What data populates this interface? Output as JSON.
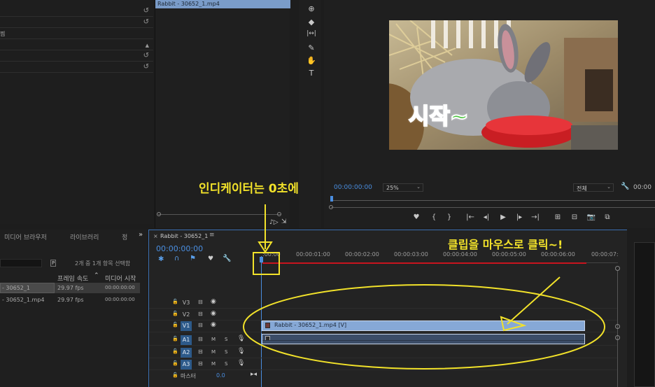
{
  "source_monitor": {
    "clip_label": "Rabbit - 30652_1.mp4",
    "left_label": "찜"
  },
  "tools": [
    {
      "name": "ripple-edit-icon",
      "glyph": "⊕"
    },
    {
      "name": "razor-icon",
      "glyph": "◆"
    },
    {
      "name": "slip-icon",
      "glyph": "|↔|"
    },
    {
      "name": "pen-icon",
      "glyph": "✎"
    },
    {
      "name": "hand-icon",
      "glyph": "✋"
    },
    {
      "name": "type-icon",
      "glyph": "T"
    }
  ],
  "program_monitor": {
    "overlay_text": "시작~",
    "timecode": "00:00:00:00",
    "zoom": "25%",
    "quality": "전체",
    "end_timecode": "00:00"
  },
  "project_panel": {
    "tabs": [
      "미디어 브라우저",
      "라이브러리",
      "정"
    ],
    "selection_info": "2개 중 1개 항목 선택함",
    "columns": [
      "프레임 속도",
      "미디어 시작"
    ],
    "items": [
      {
        "name": "- 30652_1",
        "fps": "29.97 fps",
        "start": "00:00:00:00"
      },
      {
        "name": "- 30652_1.mp4",
        "fps": "29.97 fps",
        "start": "00:00:00:00"
      }
    ]
  },
  "timeline": {
    "sequence_name": "Rabbit - 30652_1",
    "timecode": "00:00:00:00",
    "ruler": [
      ":00:00",
      "00:00:01:00",
      "00:00:02:00",
      "00:00:03:00",
      "00:00:04:00",
      "00:00:05:00",
      "00:00:06:00",
      "00:00:07:"
    ],
    "video_tracks": [
      "V3",
      "V2",
      "V1"
    ],
    "audio_tracks": [
      "A1",
      "A2",
      "A3"
    ],
    "track_m": "M",
    "track_s": "S",
    "master_label": "마스터",
    "master_value": "0.0",
    "video_clip_label": "Rabbit - 30652_1.mp4 [V]"
  },
  "annotations": {
    "indicator_note": "인디케이터는 0초에",
    "click_note": "클립을 마우스로 클릭~!"
  },
  "colors": {
    "annotation": "#f2e22a",
    "accent_blue": "#4a8ee0",
    "clip_video": "#86a8d6",
    "clip_audio": "#3c4d68",
    "work_area": "#c8141e"
  }
}
